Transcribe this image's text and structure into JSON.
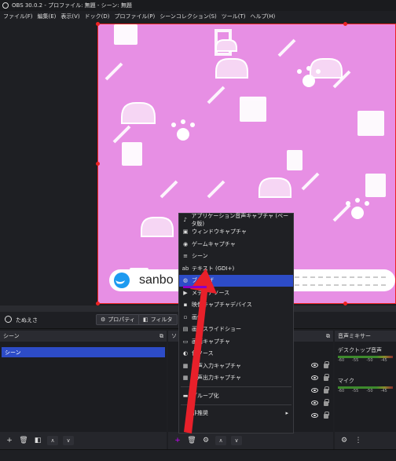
{
  "titlebar": {
    "title": "OBS 30.0.2 - プロファイル: 無題 - シーン: 無題"
  },
  "menu": [
    "ファイル(F)",
    "編集(E)",
    "表示(V)",
    "ドック(D)",
    "プロファイル(P)",
    "シーンコレクション(S)",
    "ツール(T)",
    "ヘルプ(H)"
  ],
  "preview": {
    "banner_text": "sanbo"
  },
  "source_bar": {
    "selected_source": "たぬえさ",
    "properties_label": "プロパティ",
    "filters_label": "フィルタ"
  },
  "scenes": {
    "header": "シーン",
    "items": [
      "シーン"
    ]
  },
  "sources": {
    "header": "ソ"
  },
  "mixer": {
    "header": "音声ミキサー",
    "channels": [
      {
        "name": "デスクトップ音声",
        "ticks": [
          "-60",
          "-55",
          "-50",
          "-45"
        ]
      },
      {
        "name": "マイク",
        "ticks": [
          "-60",
          "-55",
          "-50",
          "-45"
        ]
      }
    ]
  },
  "context_menu": {
    "items": [
      {
        "label": "アプリケーション音声キャプチャ (ベータ版)",
        "icon": "speaker-icon"
      },
      {
        "label": "ウィンドウキャプチャ",
        "icon": "window-icon"
      },
      {
        "label": "ゲームキャプチャ",
        "icon": "gamepad-icon"
      },
      {
        "label": "シーン",
        "icon": "list-icon"
      },
      {
        "label": "テキスト (GDI+)",
        "icon": "text-icon"
      },
      {
        "label": "ブラウザ",
        "icon": "globe-icon",
        "highlighted": true
      },
      {
        "label": "メディアソース",
        "icon": "play-icon"
      },
      {
        "label": "映像キャプチャデバイス",
        "icon": "camera-icon"
      },
      {
        "label": "画像",
        "icon": "image-icon"
      },
      {
        "label": "画像スライドショー",
        "icon": "slideshow-icon"
      },
      {
        "label": "画面キャプチャ",
        "icon": "monitor-icon"
      },
      {
        "label": "色ソース",
        "icon": "palette-icon"
      },
      {
        "label": "音声入力キャプチャ",
        "icon": "mic-icon"
      },
      {
        "label": "音声出力キャプチャ",
        "icon": "speaker-out-icon"
      },
      {
        "label": "グループ化",
        "icon": "folder-icon"
      },
      {
        "label": "非推奨",
        "icon": "",
        "submenu": true
      }
    ]
  }
}
